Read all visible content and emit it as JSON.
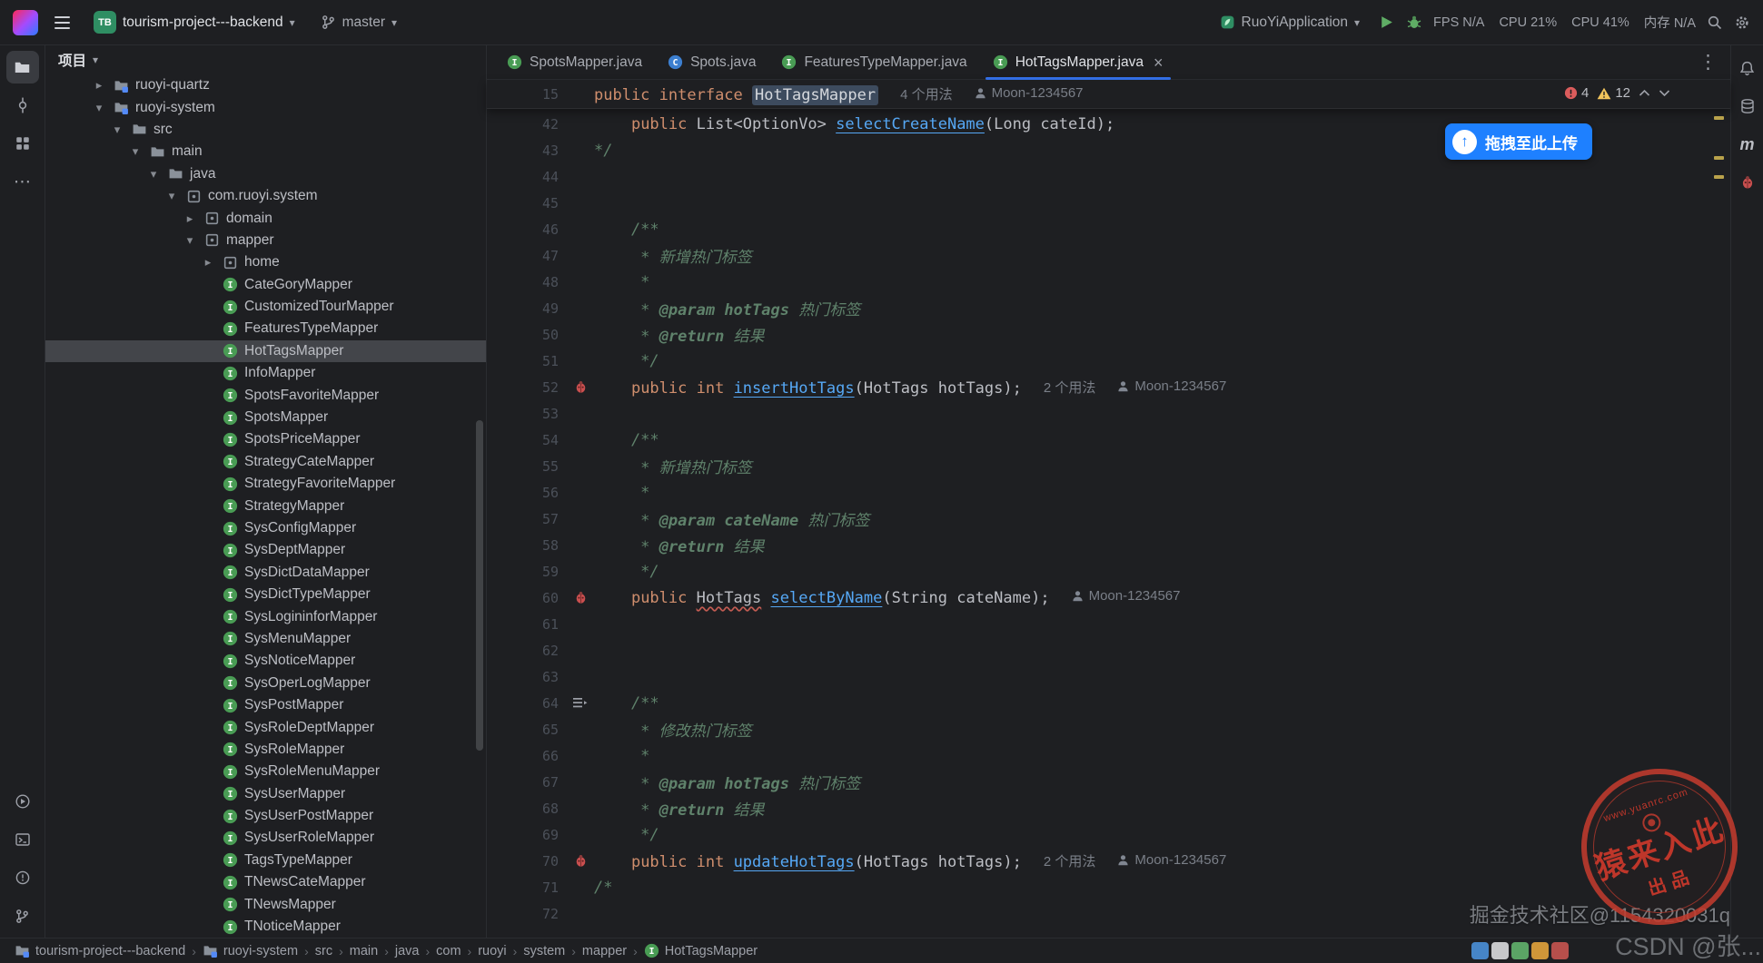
{
  "title_bar": {
    "project_badge": "TB",
    "project_name": "tourism-project---backend",
    "branch": "master",
    "run_config": "RuoYiApplication",
    "perf_stats": [
      "FPS N/A",
      "CPU 21%",
      "CPU 41%",
      "内存 N/A"
    ]
  },
  "activity_bar": {
    "left_top": [
      "project",
      "commit",
      "structure",
      "more"
    ],
    "left_bottom": [
      "run",
      "terminal",
      "problems",
      "version-control"
    ],
    "right": [
      "notifications",
      "database",
      "maven",
      "plugin-bug"
    ]
  },
  "project_panel": {
    "title": "项目",
    "tree": [
      {
        "label": "ruoyi-quartz",
        "level": 1,
        "icon": "module",
        "chevron": "right"
      },
      {
        "label": "ruoyi-system",
        "level": 1,
        "icon": "module",
        "chevron": "down"
      },
      {
        "label": "src",
        "level": 2,
        "icon": "folder",
        "chevron": "down"
      },
      {
        "label": "main",
        "level": 3,
        "icon": "folder",
        "chevron": "down"
      },
      {
        "label": "java",
        "level": 4,
        "icon": "folder",
        "chevron": "down"
      },
      {
        "label": "com.ruoyi.system",
        "level": 5,
        "icon": "package",
        "chevron": "down"
      },
      {
        "label": "domain",
        "level": 6,
        "icon": "package",
        "chevron": "right"
      },
      {
        "label": "mapper",
        "level": 6,
        "icon": "package",
        "chevron": "down"
      },
      {
        "label": "home",
        "level": 7,
        "icon": "package",
        "chevron": "right"
      },
      {
        "label": "CateGoryMapper",
        "level": 7,
        "icon": "interface"
      },
      {
        "label": "CustomizedTourMapper",
        "level": 7,
        "icon": "interface"
      },
      {
        "label": "FeaturesTypeMapper",
        "level": 7,
        "icon": "interface"
      },
      {
        "label": "HotTagsMapper",
        "level": 7,
        "icon": "interface",
        "selected": true
      },
      {
        "label": "InfoMapper",
        "level": 7,
        "icon": "interface"
      },
      {
        "label": "SpotsFavoriteMapper",
        "level": 7,
        "icon": "interface"
      },
      {
        "label": "SpotsMapper",
        "level": 7,
        "icon": "interface"
      },
      {
        "label": "SpotsPriceMapper",
        "level": 7,
        "icon": "interface"
      },
      {
        "label": "StrategyCateMapper",
        "level": 7,
        "icon": "interface"
      },
      {
        "label": "StrategyFavoriteMapper",
        "level": 7,
        "icon": "interface"
      },
      {
        "label": "StrategyMapper",
        "level": 7,
        "icon": "interface"
      },
      {
        "label": "SysConfigMapper",
        "level": 7,
        "icon": "interface"
      },
      {
        "label": "SysDeptMapper",
        "level": 7,
        "icon": "interface"
      },
      {
        "label": "SysDictDataMapper",
        "level": 7,
        "icon": "interface"
      },
      {
        "label": "SysDictTypeMapper",
        "level": 7,
        "icon": "interface"
      },
      {
        "label": "SysLogininforMapper",
        "level": 7,
        "icon": "interface"
      },
      {
        "label": "SysMenuMapper",
        "level": 7,
        "icon": "interface"
      },
      {
        "label": "SysNoticeMapper",
        "level": 7,
        "icon": "interface"
      },
      {
        "label": "SysOperLogMapper",
        "level": 7,
        "icon": "interface"
      },
      {
        "label": "SysPostMapper",
        "level": 7,
        "icon": "interface"
      },
      {
        "label": "SysRoleDeptMapper",
        "level": 7,
        "icon": "interface"
      },
      {
        "label": "SysRoleMapper",
        "level": 7,
        "icon": "interface"
      },
      {
        "label": "SysRoleMenuMapper",
        "level": 7,
        "icon": "interface"
      },
      {
        "label": "SysUserMapper",
        "level": 7,
        "icon": "interface"
      },
      {
        "label": "SysUserPostMapper",
        "level": 7,
        "icon": "interface"
      },
      {
        "label": "SysUserRoleMapper",
        "level": 7,
        "icon": "interface"
      },
      {
        "label": "TagsTypeMapper",
        "level": 7,
        "icon": "interface"
      },
      {
        "label": "TNewsCateMapper",
        "level": 7,
        "icon": "interface"
      },
      {
        "label": "TNewsMapper",
        "level": 7,
        "icon": "interface"
      },
      {
        "label": "TNoticeMapper",
        "level": 7,
        "icon": "interface"
      }
    ]
  },
  "editor": {
    "tabs": [
      {
        "label": "SpotsMapper.java",
        "icon": "interface"
      },
      {
        "label": "Spots.java",
        "icon": "class"
      },
      {
        "label": "FeaturesTypeMapper.java",
        "icon": "interface"
      },
      {
        "label": "HotTagsMapper.java",
        "icon": "interface",
        "active": true
      }
    ],
    "sticky": {
      "n": "15",
      "tok": [
        [
          "public ",
          "k"
        ],
        [
          "interface ",
          "k"
        ],
        [
          "HotTagsMapper",
          "hl"
        ]
      ],
      "inlay": "4 个用法",
      "author": "Moon-1234567"
    },
    "lines": [
      {
        "n": "42",
        "tok": [
          [
            "    ",
            "p"
          ],
          [
            "public ",
            "k"
          ],
          [
            "List<OptionVo> ",
            "p"
          ],
          [
            "selectCreateName",
            "m"
          ],
          [
            "(Long cateId);",
            "p"
          ]
        ]
      },
      {
        "n": "43",
        "tok": [
          [
            "*/",
            "c"
          ]
        ]
      },
      {
        "n": "44",
        "tok": []
      },
      {
        "n": "45",
        "tok": []
      },
      {
        "n": "46",
        "tok": [
          [
            "    /**",
            "c"
          ]
        ]
      },
      {
        "n": "47",
        "tok": [
          [
            "     * 新增热门标签",
            "c"
          ]
        ]
      },
      {
        "n": "48",
        "tok": [
          [
            "     *",
            "c"
          ]
        ]
      },
      {
        "n": "49",
        "tok": [
          [
            "     * ",
            "c"
          ],
          [
            "@param ",
            "ct"
          ],
          [
            "hotTags ",
            "ct"
          ],
          [
            "热门标签",
            "c"
          ]
        ]
      },
      {
        "n": "50",
        "tok": [
          [
            "     * ",
            "c"
          ],
          [
            "@return ",
            "ct"
          ],
          [
            "结果",
            "c"
          ]
        ]
      },
      {
        "n": "51",
        "tok": [
          [
            "     */",
            "c"
          ]
        ]
      },
      {
        "n": "52",
        "tok": [
          [
            "    ",
            "p"
          ],
          [
            "public ",
            "k"
          ],
          [
            "int ",
            "k"
          ],
          [
            "insertHotTags",
            "m"
          ],
          [
            "(HotTags hotTags);",
            "p"
          ]
        ],
        "g": "bug",
        "inlay": "2 个用法",
        "author": "Moon-1234567"
      },
      {
        "n": "53",
        "tok": []
      },
      {
        "n": "54",
        "tok": [
          [
            "    /**",
            "c"
          ]
        ]
      },
      {
        "n": "55",
        "tok": [
          [
            "     * 新增热门标签",
            "c"
          ]
        ]
      },
      {
        "n": "56",
        "tok": [
          [
            "     *",
            "c"
          ]
        ]
      },
      {
        "n": "57",
        "tok": [
          [
            "     * ",
            "c"
          ],
          [
            "@param ",
            "ct"
          ],
          [
            "cateName ",
            "ct"
          ],
          [
            "热门标签",
            "c"
          ]
        ]
      },
      {
        "n": "58",
        "tok": [
          [
            "     * ",
            "c"
          ],
          [
            "@return ",
            "ct"
          ],
          [
            "结果",
            "c"
          ]
        ]
      },
      {
        "n": "59",
        "tok": [
          [
            "     */",
            "c"
          ]
        ]
      },
      {
        "n": "60",
        "tok": [
          [
            "    ",
            "p"
          ],
          [
            "public ",
            "k"
          ],
          [
            "HotTags",
            "err"
          ],
          [
            " ",
            "p"
          ],
          [
            "selectByName",
            "m"
          ],
          [
            "(String cateName);",
            "p"
          ]
        ],
        "g": "bug",
        "author": "Moon-1234567"
      },
      {
        "n": "61",
        "tok": []
      },
      {
        "n": "62",
        "tok": []
      },
      {
        "n": "63",
        "tok": []
      },
      {
        "n": "64",
        "tok": [
          [
            "    /**",
            "c"
          ]
        ],
        "g": "menu"
      },
      {
        "n": "65",
        "tok": [
          [
            "     * 修改热门标签",
            "c"
          ]
        ]
      },
      {
        "n": "66",
        "tok": [
          [
            "     *",
            "c"
          ]
        ]
      },
      {
        "n": "67",
        "tok": [
          [
            "     * ",
            "c"
          ],
          [
            "@param ",
            "ct"
          ],
          [
            "hotTags ",
            "ct"
          ],
          [
            "热门标签",
            "c"
          ]
        ]
      },
      {
        "n": "68",
        "tok": [
          [
            "     * ",
            "c"
          ],
          [
            "@return ",
            "ct"
          ],
          [
            "结果",
            "c"
          ]
        ]
      },
      {
        "n": "69",
        "tok": [
          [
            "     */",
            "c"
          ]
        ]
      },
      {
        "n": "70",
        "tok": [
          [
            "    ",
            "p"
          ],
          [
            "public ",
            "k"
          ],
          [
            "int ",
            "k"
          ],
          [
            "updateHotTags",
            "m"
          ],
          [
            "(HotTags hotTags);",
            "p"
          ]
        ],
        "g": "bug",
        "inlay": "2 个用法",
        "author": "Moon-1234567"
      },
      {
        "n": "71",
        "tok": [
          [
            "/*",
            "c"
          ]
        ]
      },
      {
        "n": "72",
        "tok": []
      }
    ],
    "inspections": {
      "errors": "4",
      "warnings": "12"
    }
  },
  "upload_button": {
    "label": "拖拽至此上传"
  },
  "breadcrumbs": [
    {
      "label": "tourism-project---backend",
      "icon": "module"
    },
    {
      "label": "ruoyi-system",
      "icon": "module"
    },
    {
      "label": "src"
    },
    {
      "label": "main"
    },
    {
      "label": "java"
    },
    {
      "label": "com"
    },
    {
      "label": "ruoyi"
    },
    {
      "label": "system"
    },
    {
      "label": "mapper"
    },
    {
      "label": "HotTagsMapper",
      "icon": "interface"
    }
  ],
  "watermarks": {
    "juejin": "掘金技术社区@1154320031q",
    "csdn": "CSDN @张...",
    "stamp_url": "www.yuanrc.com",
    "stamp_line1": "猿来入此",
    "stamp_line2": "出品"
  },
  "ime_chips": [
    {
      "bg": "#4a90d9"
    },
    {
      "bg": "#d9dadd"
    },
    {
      "bg": "#62b36d"
    },
    {
      "bg": "#e2a33c"
    },
    {
      "bg": "#c75450"
    }
  ],
  "icons_text": {
    "chevron_down": "▾",
    "chevron_right": "▸",
    "caret": "▾",
    "more_v": "⋮",
    "close": "×",
    "crumb_sep": "›"
  },
  "colors": {
    "accent": "#3574f0",
    "upload_blue": "#1e80ff",
    "error": "#db5c5c",
    "warning": "#f2c55c",
    "stamp_red": "#c23b2e"
  }
}
